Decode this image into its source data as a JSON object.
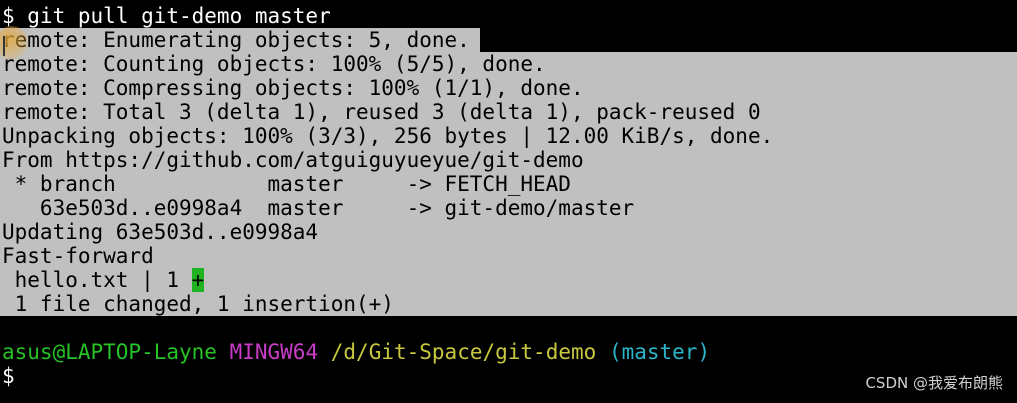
{
  "terminal": {
    "command_line": "$ git pull git-demo master",
    "lines": [
      "remote: Enumerating objects: 5, done.",
      "remote: Counting objects: 100% (5/5), done.",
      "remote: Compressing objects: 100% (1/1), done.",
      "remote: Total 3 (delta 1), reused 3 (delta 1), pack-reused 0",
      "Unpacking objects: 100% (3/3), 256 bytes | 12.00 KiB/s, done.",
      "From https://github.com/atguiguyueyue/git-demo",
      " * branch            master     -> FETCH_HEAD",
      "   63e503d..e0998a4  master     -> git-demo/master",
      "Updating 63e503d..e0998a4",
      "Fast-forward"
    ],
    "diffstat_prefix": " hello.txt | 1 ",
    "diffstat_mark": "+",
    "summary": " 1 file changed, 1 insertion(+)",
    "prompt": {
      "user_host": "asus@LAPTOP-Layne",
      "env": "MINGW64",
      "path": "/d/Git-Space/git-demo",
      "branch": "(master)"
    },
    "input_prompt": "$"
  },
  "watermark": "CSDN @我爱布朗熊",
  "colors": {
    "background": "#000000",
    "selection": "#c0c0c0",
    "diff_add": "#1fb31f",
    "user_host": "#26c226",
    "env": "#c83ec8",
    "path": "#c8c83e",
    "branch": "#2cb5c8"
  }
}
